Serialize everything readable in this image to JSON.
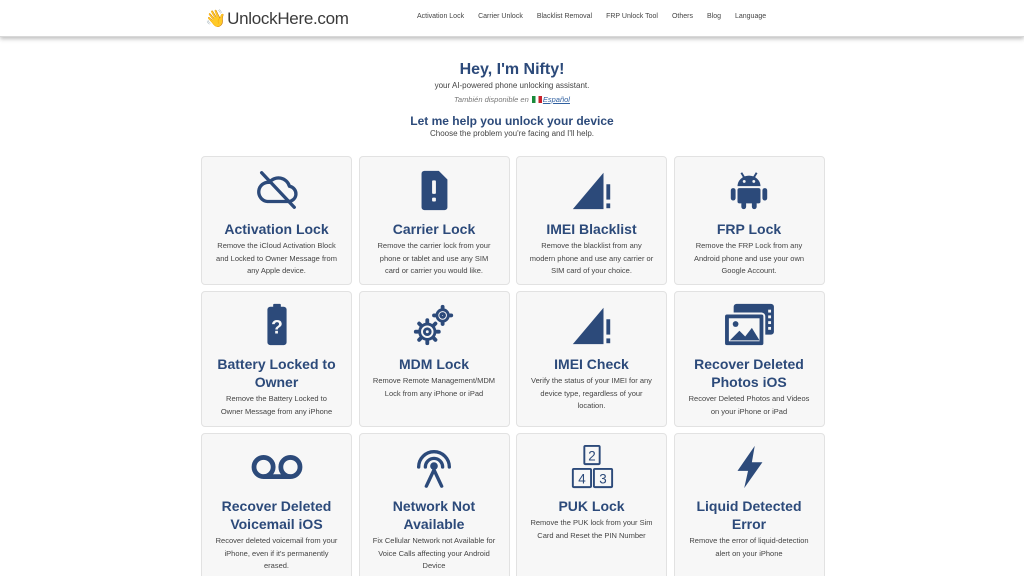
{
  "header": {
    "logo_text": "UnlockHere.com",
    "logo_icon": "waving-hand-icon",
    "nav": [
      "Activation Lock",
      "Carrier Unlock",
      "Blacklist Removal",
      "FRP Unlock Tool",
      "Others",
      "Blog",
      "Language"
    ]
  },
  "hero": {
    "greeting": "Hey, I'm Nifty!",
    "tagline": "your AI-powered phone unlocking assistant.",
    "alt_prefix": "También disponible en",
    "alt_link": "Español",
    "heading": "Let me help you unlock your device",
    "subheading": "Choose the problem you're facing and I'll help."
  },
  "cards": [
    {
      "icon": "cloud-off-icon",
      "title": "Activation Lock",
      "desc": "Remove the iCloud Activation Block and Locked to Owner Message from any Apple device."
    },
    {
      "icon": "sim-card-icon",
      "title": "Carrier Lock",
      "desc": "Remove the carrier lock from your phone or tablet and use any SIM card or carrier you would like."
    },
    {
      "icon": "signal-alert-icon",
      "title": "IMEI Blacklist",
      "desc": "Remove the blacklist from any modern phone and use any carrier or SIM card of your choice."
    },
    {
      "icon": "android-icon",
      "title": "FRP Lock",
      "desc": "Remove the FRP Lock from any Android phone and use your own Google Account."
    },
    {
      "icon": "battery-question-icon",
      "title": "Battery Locked to Owner",
      "desc": "Remove the Battery Locked to Owner Message from any iPhone"
    },
    {
      "icon": "gears-icon",
      "title": "MDM Lock",
      "desc": "Remove Remote Management/MDM Lock from any iPhone or iPad"
    },
    {
      "icon": "signal-alert-icon",
      "title": "IMEI Check",
      "desc": "Verify the status of your IMEI for any device type, regardless of your location."
    },
    {
      "icon": "photos-icon",
      "title": "Recover Deleted Photos iOS",
      "desc": "Recover Deleted Photos and Videos on your iPhone or iPad"
    },
    {
      "icon": "voicemail-icon",
      "title": "Recover Deleted Voicemail iOS",
      "desc": "Recover deleted voicemail from your iPhone, even if it's permanently erased."
    },
    {
      "icon": "antenna-icon",
      "title": "Network Not Available",
      "desc": "Fix Cellular Network not Available for Voice Calls affecting your Android Device"
    },
    {
      "icon": "keypad-numbers-icon",
      "title": "PUK Lock",
      "desc": "Remove the PUK lock from your Sim Card and Reset the PIN Number"
    },
    {
      "icon": "lightning-icon",
      "title": "Liquid Detected Error",
      "desc": "Remove the error of liquid-detection alert on your iPhone"
    }
  ],
  "colors": {
    "primary": "#2c4a7a",
    "card_bg": "#f7f7f7",
    "border": "#e2e2e2"
  }
}
